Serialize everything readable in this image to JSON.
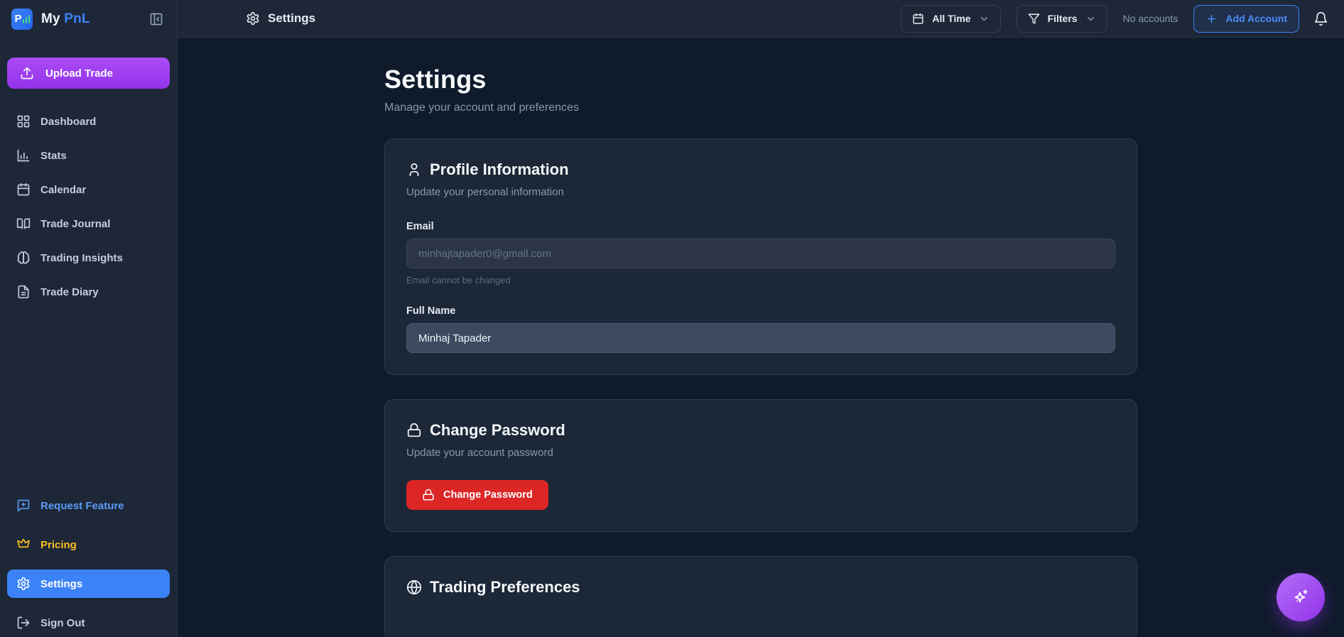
{
  "brand": {
    "my": "My",
    "pnl": "PnL"
  },
  "sidebar": {
    "upload_label": "Upload Trade",
    "items": [
      {
        "label": "Dashboard",
        "icon": "layout-grid-icon"
      },
      {
        "label": "Stats",
        "icon": "bar-chart-icon"
      },
      {
        "label": "Calendar",
        "icon": "calendar-icon"
      },
      {
        "label": "Trade Journal",
        "icon": "book-open-icon"
      },
      {
        "label": "Trading Insights",
        "icon": "brain-icon"
      },
      {
        "label": "Trade Diary",
        "icon": "file-text-icon"
      }
    ],
    "footer_items": [
      {
        "label": "Request Feature",
        "icon": "message-plus-icon"
      },
      {
        "label": "Pricing",
        "icon": "crown-icon"
      },
      {
        "label": "Settings",
        "icon": "gear-icon",
        "active": true
      },
      {
        "label": "Sign Out",
        "icon": "logout-icon"
      }
    ]
  },
  "topbar": {
    "title": "Settings",
    "time_filter_label": "All Time",
    "filters_label": "Filters",
    "no_accounts_text": "No accounts",
    "add_account_label": "Add Account"
  },
  "main": {
    "heading": "Settings",
    "subheading": "Manage your account and preferences",
    "profile_card": {
      "title": "Profile Information",
      "subtitle": "Update your personal information",
      "email_label": "Email",
      "email_value": "minhajtapader0@gmail.com",
      "email_note": "Email cannot be changed",
      "fullname_label": "Full Name",
      "fullname_value": "Minhaj Tapader"
    },
    "password_card": {
      "title": "Change Password",
      "subtitle": "Update your account password",
      "button_label": "Change Password"
    },
    "trading_card": {
      "title": "Trading Preferences"
    }
  },
  "colors": {
    "background": "#0f1a2b",
    "panel": "#1d2737",
    "card": "#1c2737",
    "accent_blue": "#3b82f6",
    "accent_purple": "#9333ea",
    "accent_gold": "#fbbf24",
    "danger_red": "#dc2626",
    "muted_text": "#8b99ad"
  }
}
